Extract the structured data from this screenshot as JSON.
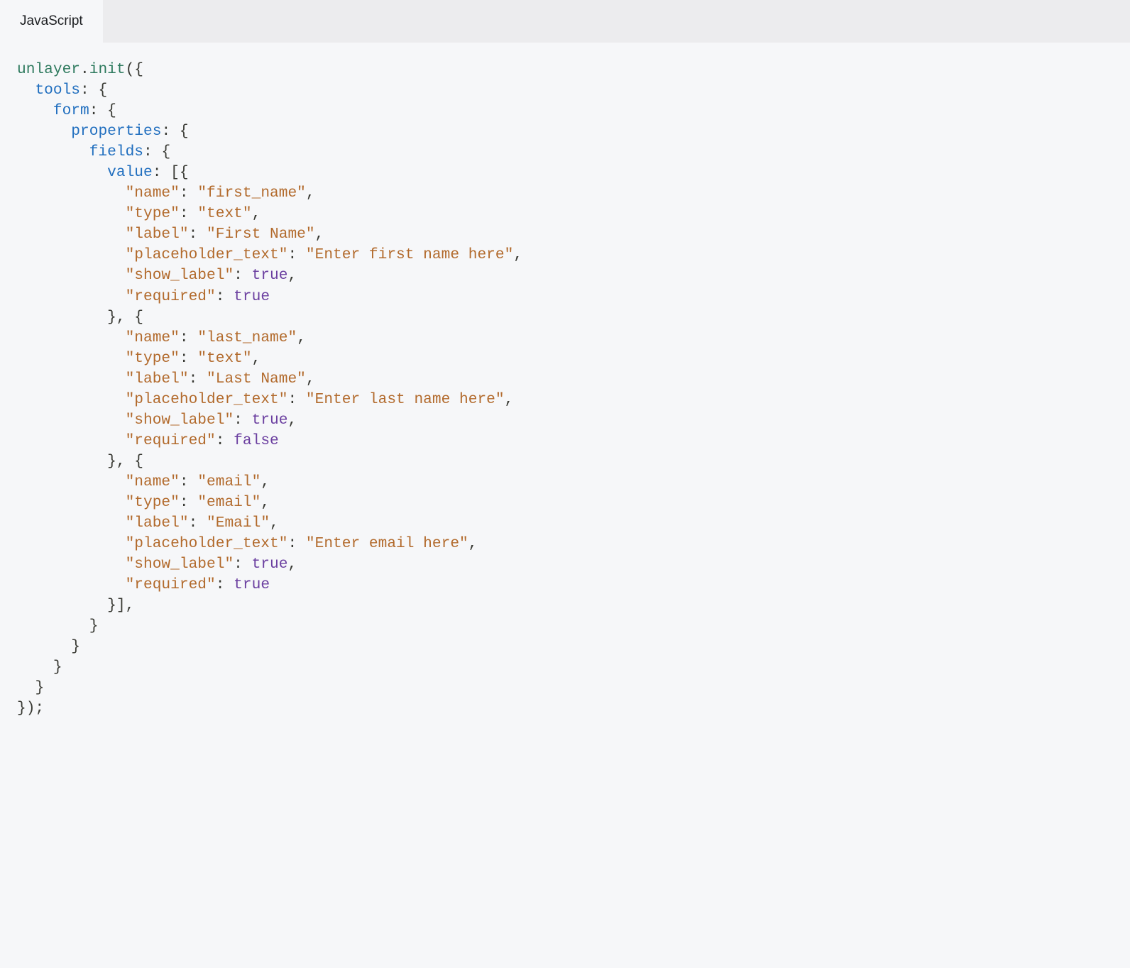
{
  "tab": {
    "label": "JavaScript"
  },
  "code": {
    "object": "unlayer",
    "method": "init",
    "keys": {
      "tools": "tools",
      "form": "form",
      "properties": "properties",
      "fields": "fields",
      "value": "value"
    },
    "field_keys": {
      "name": "\"name\"",
      "type": "\"type\"",
      "label": "\"label\"",
      "placeholder_text": "\"placeholder_text\"",
      "show_label": "\"show_label\"",
      "required": "\"required\""
    },
    "entries": [
      {
        "name": "\"first_name\"",
        "type": "\"text\"",
        "label": "\"First Name\"",
        "placeholder_text": "\"Enter first name here\"",
        "show_label": "true",
        "required": "true"
      },
      {
        "name": "\"last_name\"",
        "type": "\"text\"",
        "label": "\"Last Name\"",
        "placeholder_text": "\"Enter last name here\"",
        "show_label": "true",
        "required": "false"
      },
      {
        "name": "\"email\"",
        "type": "\"email\"",
        "label": "\"Email\"",
        "placeholder_text": "\"Enter email here\"",
        "show_label": "true",
        "required": "true"
      }
    ]
  }
}
